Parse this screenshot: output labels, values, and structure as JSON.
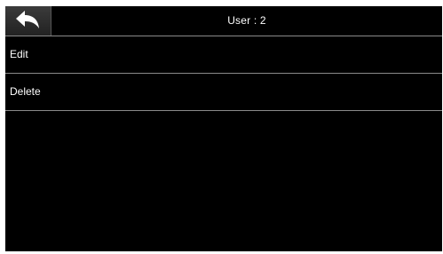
{
  "header": {
    "back_icon": "back-arrow-icon",
    "title": "User : 2"
  },
  "menu": {
    "items": [
      {
        "label": "Edit"
      },
      {
        "label": "Delete"
      }
    ]
  },
  "colors": {
    "background": "#000000",
    "text": "#ffffff",
    "divider": "#8a8a8a",
    "back_button": "#2e2e2e"
  }
}
